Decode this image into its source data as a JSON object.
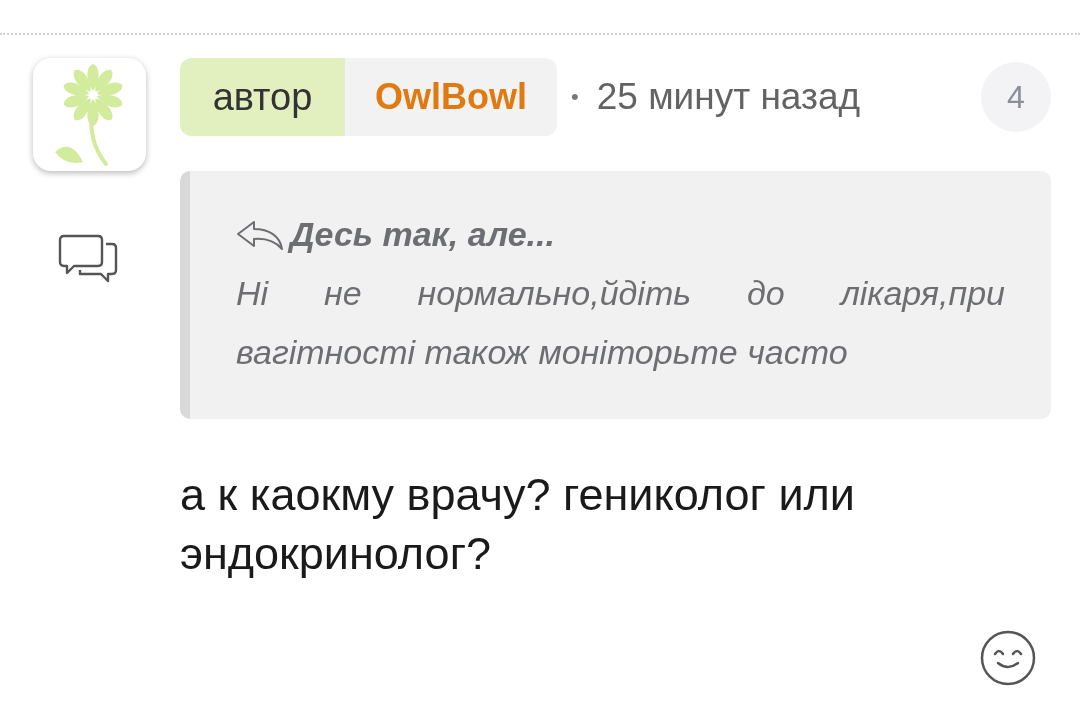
{
  "comment": {
    "author": {
      "role_label": "автор",
      "name": "OwlBowl"
    },
    "separator": "•",
    "time": "25 минут назад",
    "count": "4",
    "quote": {
      "title": "Десь так, але...",
      "text": "Ні не нормально,йдіть до лікаря,при вагітності також моніторьте часто"
    },
    "message": "а к каокму врачу? гениколог или эндокринолог?"
  }
}
